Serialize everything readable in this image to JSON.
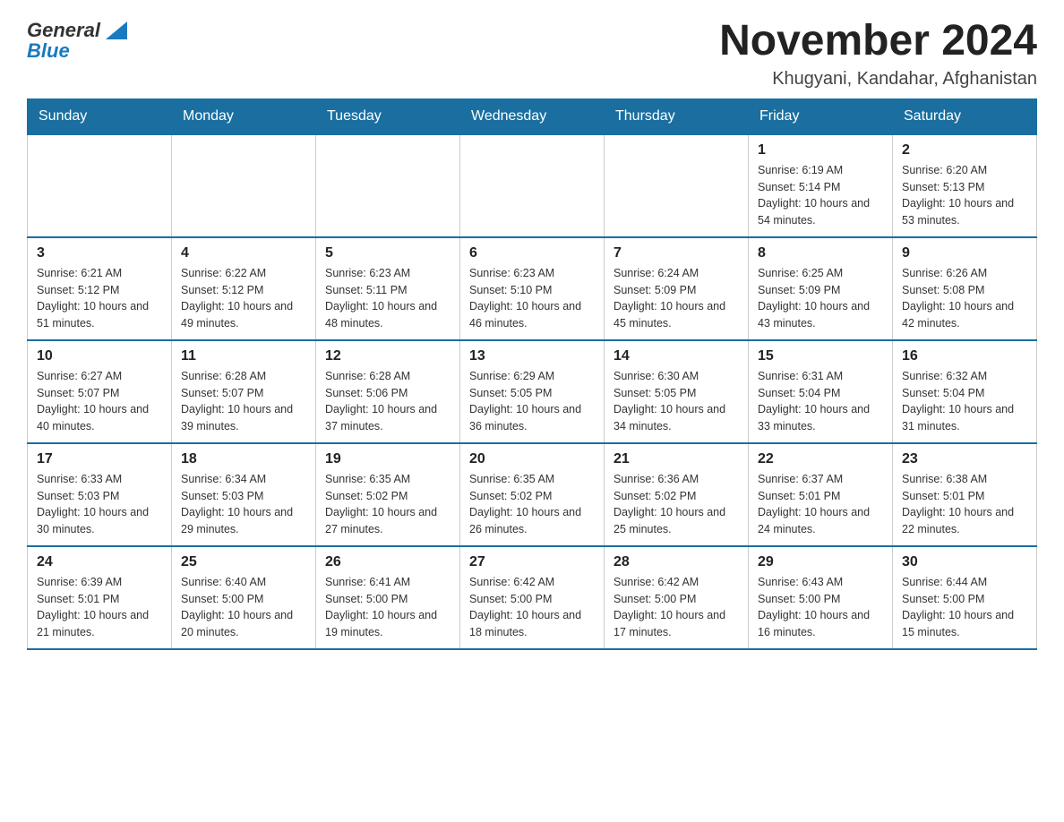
{
  "logo": {
    "general": "General",
    "blue": "Blue"
  },
  "title": "November 2024",
  "subtitle": "Khugyani, Kandahar, Afghanistan",
  "weekdays": [
    "Sunday",
    "Monday",
    "Tuesday",
    "Wednesday",
    "Thursday",
    "Friday",
    "Saturday"
  ],
  "weeks": [
    [
      {
        "day": "",
        "info": ""
      },
      {
        "day": "",
        "info": ""
      },
      {
        "day": "",
        "info": ""
      },
      {
        "day": "",
        "info": ""
      },
      {
        "day": "",
        "info": ""
      },
      {
        "day": "1",
        "info": "Sunrise: 6:19 AM\nSunset: 5:14 PM\nDaylight: 10 hours and 54 minutes."
      },
      {
        "day": "2",
        "info": "Sunrise: 6:20 AM\nSunset: 5:13 PM\nDaylight: 10 hours and 53 minutes."
      }
    ],
    [
      {
        "day": "3",
        "info": "Sunrise: 6:21 AM\nSunset: 5:12 PM\nDaylight: 10 hours and 51 minutes."
      },
      {
        "day": "4",
        "info": "Sunrise: 6:22 AM\nSunset: 5:12 PM\nDaylight: 10 hours and 49 minutes."
      },
      {
        "day": "5",
        "info": "Sunrise: 6:23 AM\nSunset: 5:11 PM\nDaylight: 10 hours and 48 minutes."
      },
      {
        "day": "6",
        "info": "Sunrise: 6:23 AM\nSunset: 5:10 PM\nDaylight: 10 hours and 46 minutes."
      },
      {
        "day": "7",
        "info": "Sunrise: 6:24 AM\nSunset: 5:09 PM\nDaylight: 10 hours and 45 minutes."
      },
      {
        "day": "8",
        "info": "Sunrise: 6:25 AM\nSunset: 5:09 PM\nDaylight: 10 hours and 43 minutes."
      },
      {
        "day": "9",
        "info": "Sunrise: 6:26 AM\nSunset: 5:08 PM\nDaylight: 10 hours and 42 minutes."
      }
    ],
    [
      {
        "day": "10",
        "info": "Sunrise: 6:27 AM\nSunset: 5:07 PM\nDaylight: 10 hours and 40 minutes."
      },
      {
        "day": "11",
        "info": "Sunrise: 6:28 AM\nSunset: 5:07 PM\nDaylight: 10 hours and 39 minutes."
      },
      {
        "day": "12",
        "info": "Sunrise: 6:28 AM\nSunset: 5:06 PM\nDaylight: 10 hours and 37 minutes."
      },
      {
        "day": "13",
        "info": "Sunrise: 6:29 AM\nSunset: 5:05 PM\nDaylight: 10 hours and 36 minutes."
      },
      {
        "day": "14",
        "info": "Sunrise: 6:30 AM\nSunset: 5:05 PM\nDaylight: 10 hours and 34 minutes."
      },
      {
        "day": "15",
        "info": "Sunrise: 6:31 AM\nSunset: 5:04 PM\nDaylight: 10 hours and 33 minutes."
      },
      {
        "day": "16",
        "info": "Sunrise: 6:32 AM\nSunset: 5:04 PM\nDaylight: 10 hours and 31 minutes."
      }
    ],
    [
      {
        "day": "17",
        "info": "Sunrise: 6:33 AM\nSunset: 5:03 PM\nDaylight: 10 hours and 30 minutes."
      },
      {
        "day": "18",
        "info": "Sunrise: 6:34 AM\nSunset: 5:03 PM\nDaylight: 10 hours and 29 minutes."
      },
      {
        "day": "19",
        "info": "Sunrise: 6:35 AM\nSunset: 5:02 PM\nDaylight: 10 hours and 27 minutes."
      },
      {
        "day": "20",
        "info": "Sunrise: 6:35 AM\nSunset: 5:02 PM\nDaylight: 10 hours and 26 minutes."
      },
      {
        "day": "21",
        "info": "Sunrise: 6:36 AM\nSunset: 5:02 PM\nDaylight: 10 hours and 25 minutes."
      },
      {
        "day": "22",
        "info": "Sunrise: 6:37 AM\nSunset: 5:01 PM\nDaylight: 10 hours and 24 minutes."
      },
      {
        "day": "23",
        "info": "Sunrise: 6:38 AM\nSunset: 5:01 PM\nDaylight: 10 hours and 22 minutes."
      }
    ],
    [
      {
        "day": "24",
        "info": "Sunrise: 6:39 AM\nSunset: 5:01 PM\nDaylight: 10 hours and 21 minutes."
      },
      {
        "day": "25",
        "info": "Sunrise: 6:40 AM\nSunset: 5:00 PM\nDaylight: 10 hours and 20 minutes."
      },
      {
        "day": "26",
        "info": "Sunrise: 6:41 AM\nSunset: 5:00 PM\nDaylight: 10 hours and 19 minutes."
      },
      {
        "day": "27",
        "info": "Sunrise: 6:42 AM\nSunset: 5:00 PM\nDaylight: 10 hours and 18 minutes."
      },
      {
        "day": "28",
        "info": "Sunrise: 6:42 AM\nSunset: 5:00 PM\nDaylight: 10 hours and 17 minutes."
      },
      {
        "day": "29",
        "info": "Sunrise: 6:43 AM\nSunset: 5:00 PM\nDaylight: 10 hours and 16 minutes."
      },
      {
        "day": "30",
        "info": "Sunrise: 6:44 AM\nSunset: 5:00 PM\nDaylight: 10 hours and 15 minutes."
      }
    ]
  ]
}
